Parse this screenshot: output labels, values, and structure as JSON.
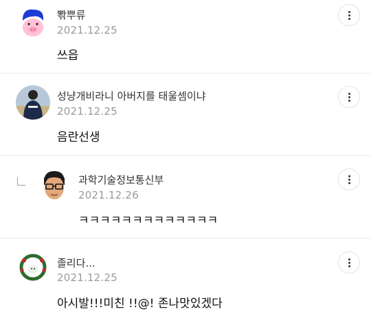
{
  "comments": [
    {
      "nickname": "뽞뿌류",
      "date": "2021.12.25",
      "text": "쓰읍",
      "avatar_icon": "pig-avatar-icon"
    },
    {
      "nickname": "성냥개비라니 아버지를 태울셈이냐",
      "date": "2021.12.25",
      "text": "음란선생",
      "avatar_icon": "person-avatar-icon"
    },
    {
      "nickname": "과학기술정보통신부",
      "date": "2021.12.26",
      "text": "ㅋㅋㅋㅋㅋㅋㅋㅋㅋㅋㅋㅋㅋ",
      "avatar_icon": "glasses-man-avatar-icon",
      "is_reply": true
    },
    {
      "nickname": "졸리다...",
      "date": "2021.12.25",
      "text": "아시발!!!미친 !!@! 존나맛있겠다",
      "avatar_icon": "wreath-avatar-icon"
    }
  ],
  "colors": {
    "date": "#9a9a9a",
    "divider": "#ececec",
    "text": "#111111"
  }
}
